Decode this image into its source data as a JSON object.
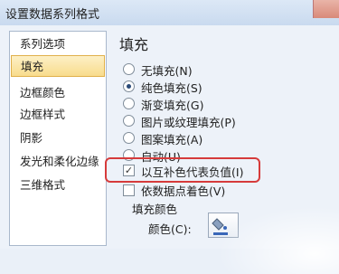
{
  "window": {
    "title": "设置数据系列格式"
  },
  "sidebar": {
    "items": [
      {
        "label": "系列选项"
      },
      {
        "label": "填充"
      },
      {
        "label": "边框颜色"
      },
      {
        "label": "边框样式"
      },
      {
        "label": "阴影"
      },
      {
        "label": "发光和柔化边缘"
      },
      {
        "label": "三维格式"
      }
    ],
    "selected_index": 1
  },
  "panel": {
    "title": "填充",
    "fill_options": [
      {
        "label": "无填充(N)",
        "selected": false
      },
      {
        "label": "纯色填充(S)",
        "selected": true
      },
      {
        "label": "渐变填充(G)",
        "selected": false
      },
      {
        "label": "图片或纹理填充(P)",
        "selected": false
      },
      {
        "label": "图案填充(A)",
        "selected": false
      },
      {
        "label": "自动(U)",
        "selected": false
      }
    ],
    "invert_if_negative": {
      "label": "以互补色代表负值(I)",
      "checked": true
    },
    "vary_colors": {
      "label": "依数据点着色(V)",
      "checked": false
    },
    "fill_color_section": "填充颜色",
    "color_label": "颜色(C):"
  }
}
